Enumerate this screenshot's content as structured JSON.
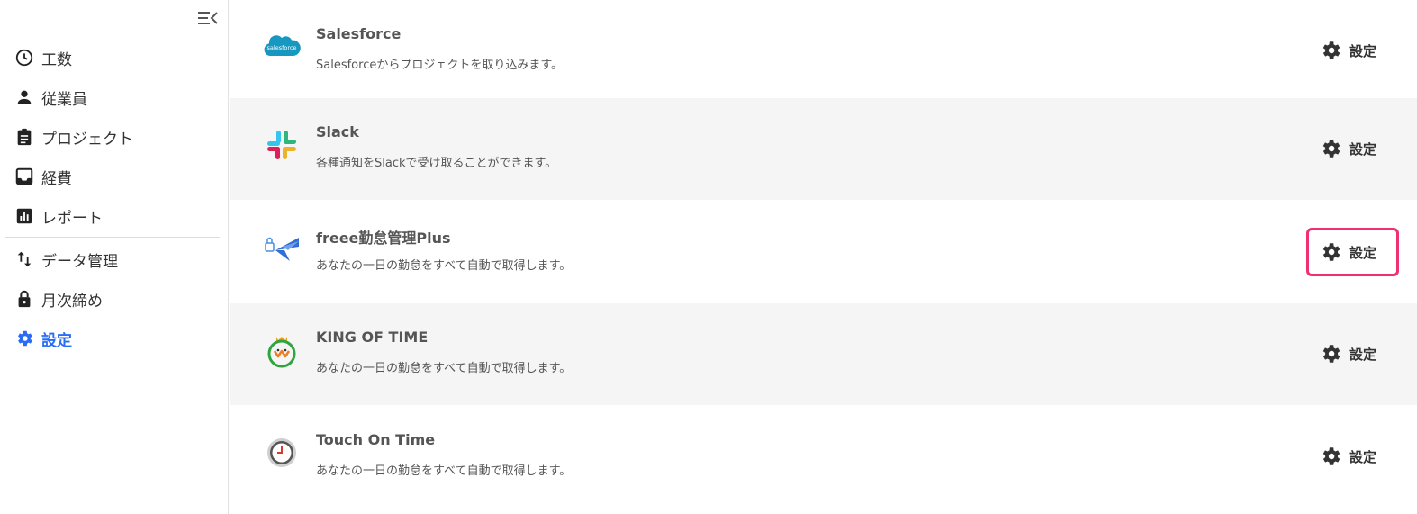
{
  "sidebar": {
    "items": [
      {
        "label": "工数",
        "icon": "clock-icon",
        "active": false
      },
      {
        "label": "従業員",
        "icon": "person-icon",
        "active": false
      },
      {
        "label": "プロジェクト",
        "icon": "clipboard-icon",
        "active": false
      },
      {
        "label": "経費",
        "icon": "inbox-icon",
        "active": false
      },
      {
        "label": "レポート",
        "icon": "bar-chart-icon",
        "active": false
      },
      {
        "label": "データ管理",
        "icon": "swap-vertical-icon",
        "active": false
      },
      {
        "label": "月次締め",
        "icon": "lock-icon",
        "active": false
      },
      {
        "label": "設定",
        "icon": "gear-icon",
        "active": true
      }
    ]
  },
  "integrations": [
    {
      "name": "Salesforce",
      "description": "Salesforceからプロジェクトを取り込みます。",
      "logo": "salesforce-logo",
      "logo_text": "salesforce",
      "settings_label": "設定"
    },
    {
      "name": "Slack",
      "description": "各種通知をSlackで受け取ることができます。",
      "logo": "slack-logo",
      "settings_label": "設定"
    },
    {
      "name": "freee勤怠管理Plus",
      "description": "あなたの一日の勤怠をすべて自動で取得します。",
      "logo": "freee-logo",
      "settings_label": "設定"
    },
    {
      "name": "KING OF TIME",
      "description": "あなたの一日の勤怠をすべて自動で取得します。",
      "logo": "king-of-time-logo",
      "settings_label": "設定"
    },
    {
      "name": "Touch On Time",
      "description": "あなたの一日の勤怠をすべて自動で取得します。",
      "logo": "touch-on-time-logo",
      "settings_label": "設定"
    }
  ],
  "colors": {
    "accent": "#2a6df4",
    "highlight_border": "#f0316f",
    "row_alt_bg": "#f6f5f5"
  }
}
